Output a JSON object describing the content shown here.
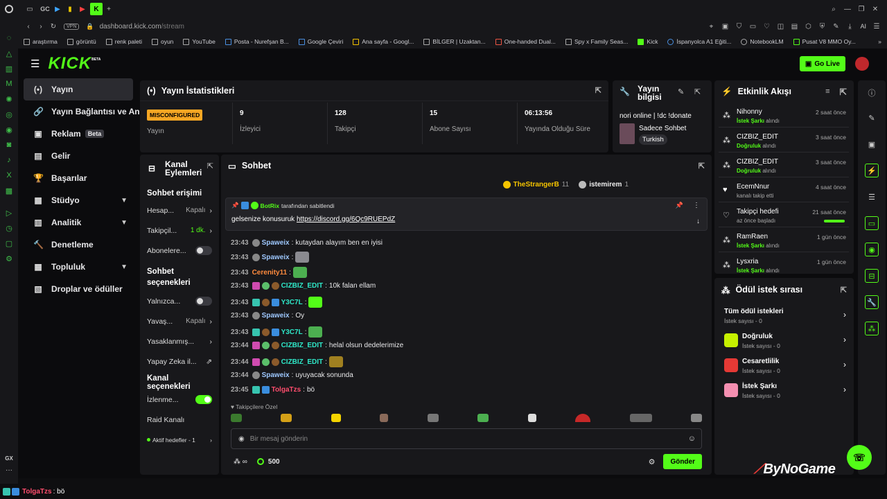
{
  "browser": {
    "tab_gc": "GC",
    "tab_add": "+",
    "url_prefix": "dashboard.kick.com",
    "url_path": "/stream",
    "vpn": "VPN",
    "ai": "AI"
  },
  "bookmarks": [
    "araştırma",
    "görüntü",
    "renk paleti",
    "oyun",
    "YouTube",
    "Posta - Nurefşan B...",
    "Google Çeviri",
    "Ana sayfa - Googl...",
    "BİLGER | Uzaktan...",
    "One-handed Dual...",
    "Spy x Family Seas...",
    "Kick",
    "İspanyolca A1 Eğiti...",
    "NotebookLM",
    "Pusat V8 MMO Oy..."
  ],
  "header": {
    "logo": "KICK",
    "logo_beta": "BETA",
    "go_live": "Go Live"
  },
  "nav": [
    {
      "label": "Yayın",
      "icon": "(•)"
    },
    {
      "label": "Yayın Bağlantısı ve Anahtarı",
      "icon": "🔗"
    },
    {
      "label": "Reklam",
      "icon": "▣",
      "badge": "Beta"
    },
    {
      "label": "Gelir",
      "icon": "▤"
    },
    {
      "label": "Başarılar",
      "icon": "🏆"
    },
    {
      "label": "Stüdyo",
      "icon": "▦"
    },
    {
      "label": "Analitik",
      "icon": "▥"
    },
    {
      "label": "Denetleme",
      "icon": "🔨"
    },
    {
      "label": "Topluluk",
      "icon": "▦"
    },
    {
      "label": "Droplar ve ödüller",
      "icon": "▧"
    }
  ],
  "stats": {
    "title": "Yayın İstatistikleri",
    "status_badge": "MISCONFIGURED",
    "status_label": "Yayın",
    "viewers": "9",
    "viewers_label": "İzleyici",
    "followers": "128",
    "followers_label": "Takipçi",
    "subs": "15",
    "subs_label": "Abone Sayısı",
    "uptime": "06:13:56",
    "uptime_label": "Yayında Olduğu Süre"
  },
  "stream_info": {
    "title_line1": "Yayın",
    "title_line2": "bilgisi",
    "stream_title": "nori online | !dc !donate",
    "category": "Sadece Sohbet",
    "language": "Turkish"
  },
  "actions": {
    "title_line1": "Kanal",
    "title_line2": "Eylemleri",
    "chat_access": "Sohbet erişimi",
    "rows1": [
      {
        "label": "Hesap...",
        "value": "Kapalı"
      },
      {
        "label": "Takipçil...",
        "value": "1 dk."
      }
    ],
    "subs_row": "Abonelere...",
    "chat_options_1": "Sohbet",
    "chat_options_2": "seçenekleri",
    "rows2": [
      {
        "label": "Yalnızca...",
        "value": ""
      },
      {
        "label": "Yavaş...",
        "value": "Kapalı"
      },
      {
        "label": "Yasaklanmış...",
        "value": ""
      },
      {
        "label": "Yapay Zeka il...",
        "value": ""
      }
    ],
    "channel_options": "Kanal seçenekleri",
    "watch_row": "İzlenme...",
    "raid": "Raid Kanalı",
    "goals": "Aktif hedefler - 1"
  },
  "chat": {
    "title": "Sohbet",
    "top1_name": "TheStrangerB",
    "top1_count": "11",
    "top2_name": "istemirem",
    "top2_count": "1",
    "pinned_by_user": "BotRix",
    "pinned_by_text": "tarafından sabitlendi",
    "pinned_msg_text": "gelsenize konusuruk",
    "pinned_link": "https://discord.gg/6Qc9RUEPdZ",
    "messages": [
      {
        "time": "23:43",
        "user": "Spaweix",
        "text": "kutaydan alayım ben en iyisi"
      },
      {
        "time": "23:43",
        "user": "Spaweix",
        "text": ""
      },
      {
        "time": "23:43",
        "user": "Cerenity11",
        "text": ""
      },
      {
        "time": "23:43",
        "user": "CIZBIZ_EDIT",
        "text": "10k falan ellam"
      },
      {
        "time": "23:43",
        "user": "Y3C7L",
        "text": ""
      },
      {
        "time": "23:43",
        "user": "Spaweix",
        "text": "Oy"
      },
      {
        "time": "23:43",
        "user": "Y3C7L",
        "text": ""
      },
      {
        "time": "23:44",
        "user": "CIZBIZ_EDIT",
        "text": "helal olsun dedelerimize"
      },
      {
        "time": "23:44",
        "user": "CIZBIZ_EDIT",
        "text": ""
      },
      {
        "time": "23:44",
        "user": "Spaweix",
        "text": "uyuyacak sonunda"
      },
      {
        "time": "23:45",
        "user": "TolgaTzs",
        "text": "bö"
      }
    ],
    "follower_only": "Takipçilere Özel",
    "input_placeholder": "Bir mesaj gönderin",
    "points": "500",
    "send": "Gönder"
  },
  "feed": {
    "title": "Etkinlik Akışı",
    "items": [
      {
        "name": "Nihonny",
        "sub_hl": "İstek Şarkı",
        "sub": "alındı",
        "time": "2 saat önce"
      },
      {
        "name": "CIZBIZ_EDIT",
        "sub_hl": "Doğruluk",
        "sub": "alındı",
        "time": "3 saat önce"
      },
      {
        "name": "CIZBIZ_EDIT",
        "sub_hl": "Doğruluk",
        "sub": "alındı",
        "time": "3 saat önce"
      },
      {
        "name": "EcemNnur",
        "sub_hl": "",
        "sub": "kanalı takip etti",
        "time": "4 saat önce"
      },
      {
        "name": "Takipçi hedefi",
        "sub_hl": "",
        "sub": "az önce başladı",
        "time": "21 saat önce"
      },
      {
        "name": "RamRaen",
        "sub_hl": "İstek Şarkı",
        "sub": "alındı",
        "time": "1 gün önce"
      },
      {
        "name": "Lysxria",
        "sub_hl": "İstek Şarkı",
        "sub": "alındı",
        "time": "1 gün önce"
      }
    ]
  },
  "rewards": {
    "title": "Ödül istek sırası",
    "all_title": "Tüm ödül istekleri",
    "all_sub": "İstek sayısı - 0",
    "items": [
      {
        "title": "Doğruluk",
        "sub": "İstek sayısı - 0",
        "color": "#c6f000"
      },
      {
        "title": "Cesaretlilik",
        "sub": "İstek sayısı - 0",
        "color": "#e53935"
      },
      {
        "title": "İstek Şarkı",
        "sub": "İstek sayısı - 0",
        "color": "#f48fb1"
      }
    ]
  },
  "watermark": "ByNoGame",
  "overlay_chat": {
    "user": "TolgaTzs",
    "text": ": bö"
  },
  "colors": {
    "accent": "#53fc18",
    "bg": "#0b0b0d",
    "panel": "#18181b"
  }
}
